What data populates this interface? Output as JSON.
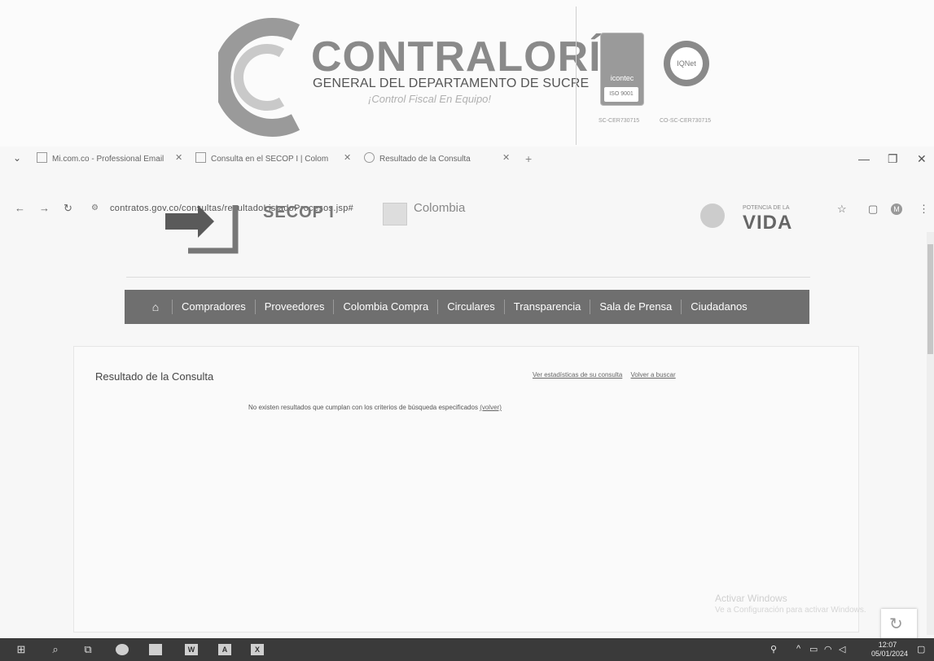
{
  "letterhead": {
    "org_name": "CONTRALORÍA",
    "org_subtitle": "GENERAL DEL DEPARTAMENTO DE SUCRE",
    "slogan": "¡Control Fiscal En Equipo!",
    "cert1_label": "icontec",
    "cert1_iso": "ISO 9001",
    "cert2_label": "IQNet",
    "cert1_code": "SC-CER730715",
    "cert2_code": "CO-SC-CER730715"
  },
  "browser": {
    "tabs": [
      {
        "label": "Mi.com.co - Professional Email"
      },
      {
        "label": "Consulta en el SECOP I | Colom"
      },
      {
        "label": "Resultado de la Consulta"
      }
    ],
    "url": "contratos.gov.co/consultas/resultadoListadoProcesos.jsp#"
  },
  "site": {
    "secop_title": "SECOP I",
    "colombia_label": "Colombia",
    "vida_sub": "POTENCIA DE LA",
    "vida_word": "VIDA",
    "nav": [
      "Compradores",
      "Proveedores",
      "Colombia Compra",
      "Circulares",
      "Transparencia",
      "Sala de Prensa",
      "Ciudadanos"
    ]
  },
  "result": {
    "title": "Resultado de la Consulta",
    "link_stats": "Ver estadísticas de su consulta",
    "link_back": "Volver a buscar",
    "no_results": "No existen resultados que cumplan con los criterios de búsqueda especificados",
    "volver": "(volver)"
  },
  "watermark": {
    "line1": "Activar Windows",
    "line2": "Ve a Configuración para activar Windows."
  },
  "taskbar": {
    "time": "12:07",
    "date": "05/01/2024"
  }
}
